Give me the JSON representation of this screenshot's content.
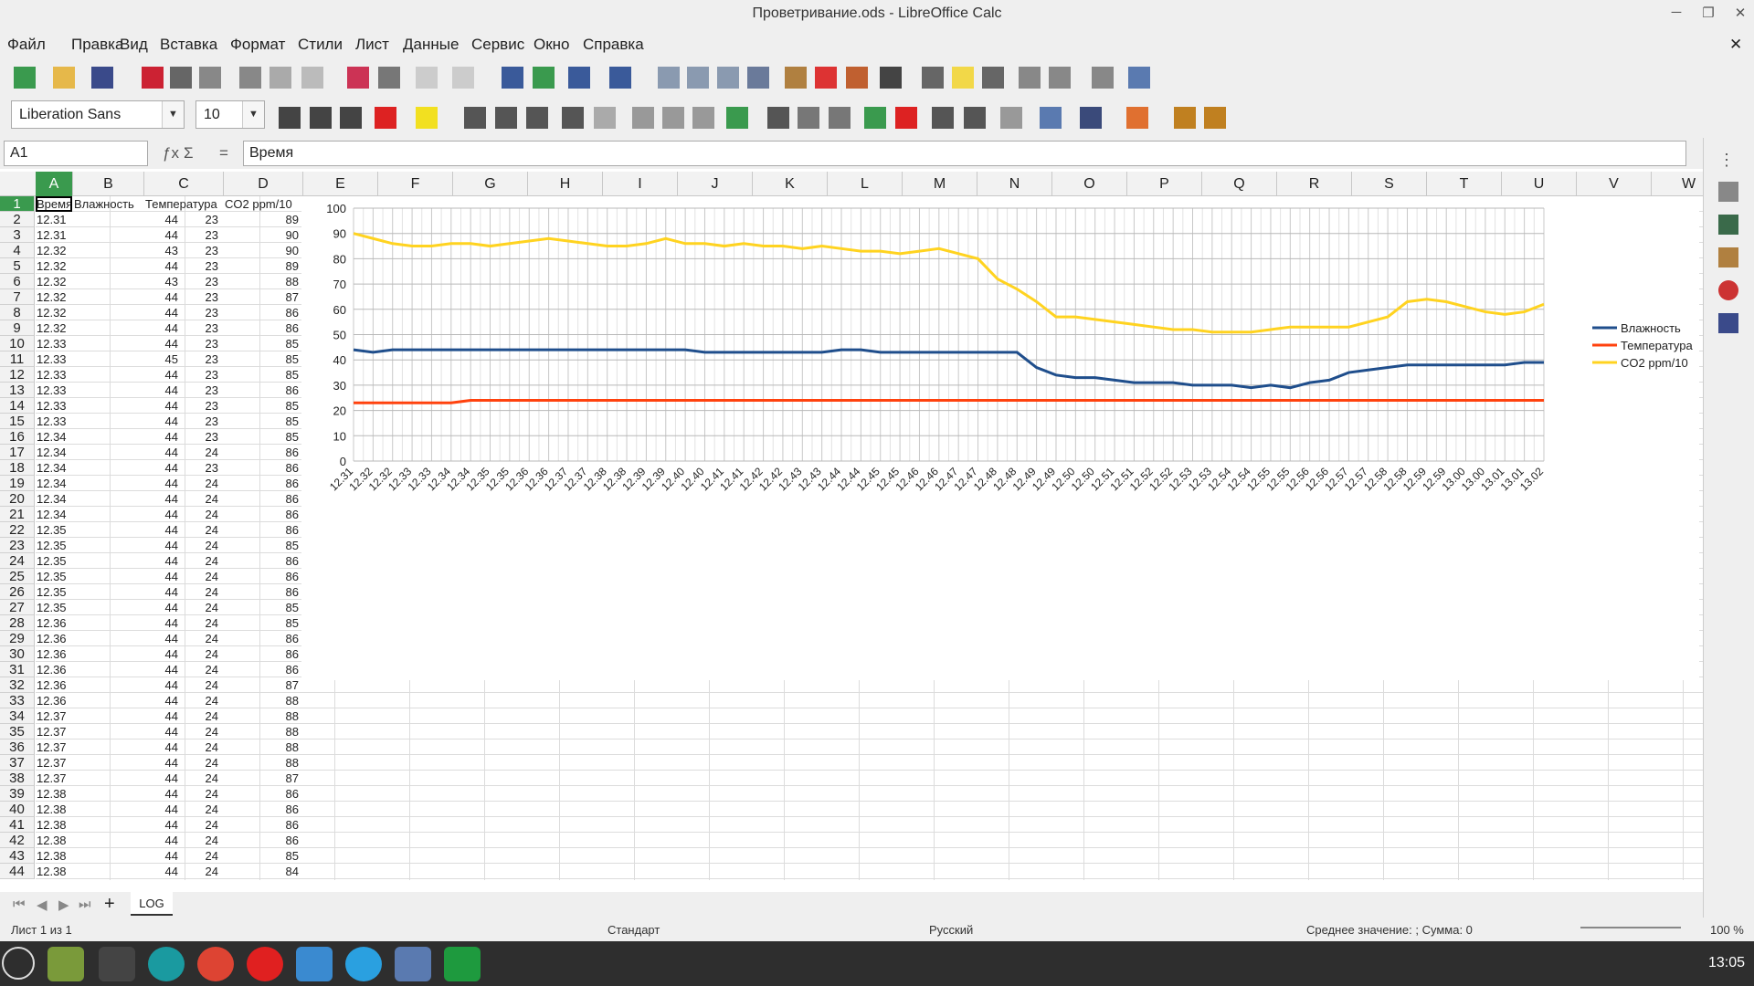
{
  "window": {
    "title": "Проветривание.ods - LibreOffice Calc"
  },
  "menu": [
    "Файл",
    "Правка",
    "Вид",
    "Вставка",
    "Формат",
    "Стили",
    "Лист",
    "Данные",
    "Сервис",
    "Окно",
    "Справка"
  ],
  "font": {
    "name": "Liberation Sans",
    "size": "10"
  },
  "formula": {
    "cell": "A1",
    "value": "Время"
  },
  "columns": [
    "A",
    "B",
    "C",
    "D",
    "E",
    "F",
    "G",
    "H",
    "I",
    "J",
    "K",
    "L",
    "M",
    "N",
    "O",
    "P",
    "Q",
    "R",
    "S",
    "T",
    "U",
    "V",
    "W"
  ],
  "header_row": [
    "Время",
    "Влажность",
    "Температура",
    "CO2 ppm/10"
  ],
  "rows": [
    [
      "12.31",
      "44",
      "23",
      "89"
    ],
    [
      "12.31",
      "44",
      "23",
      "90"
    ],
    [
      "12.32",
      "43",
      "23",
      "90"
    ],
    [
      "12.32",
      "44",
      "23",
      "89"
    ],
    [
      "12.32",
      "43",
      "23",
      "88"
    ],
    [
      "12.32",
      "44",
      "23",
      "87"
    ],
    [
      "12.32",
      "44",
      "23",
      "86"
    ],
    [
      "12.32",
      "44",
      "23",
      "86"
    ],
    [
      "12.33",
      "44",
      "23",
      "85"
    ],
    [
      "12.33",
      "45",
      "23",
      "85"
    ],
    [
      "12.33",
      "44",
      "23",
      "85"
    ],
    [
      "12.33",
      "44",
      "23",
      "86"
    ],
    [
      "12.33",
      "44",
      "23",
      "85"
    ],
    [
      "12.33",
      "44",
      "23",
      "85"
    ],
    [
      "12.34",
      "44",
      "23",
      "85"
    ],
    [
      "12.34",
      "44",
      "24",
      "86"
    ],
    [
      "12.34",
      "44",
      "23",
      "86"
    ],
    [
      "12.34",
      "44",
      "24",
      "86"
    ],
    [
      "12.34",
      "44",
      "24",
      "86"
    ],
    [
      "12.34",
      "44",
      "24",
      "86"
    ],
    [
      "12.35",
      "44",
      "24",
      "86"
    ],
    [
      "12.35",
      "44",
      "24",
      "85"
    ],
    [
      "12.35",
      "44",
      "24",
      "86"
    ],
    [
      "12.35",
      "44",
      "24",
      "86"
    ],
    [
      "12.35",
      "44",
      "24",
      "86"
    ],
    [
      "12.35",
      "44",
      "24",
      "85"
    ],
    [
      "12.36",
      "44",
      "24",
      "85"
    ],
    [
      "12.36",
      "44",
      "24",
      "86"
    ],
    [
      "12.36",
      "44",
      "24",
      "86"
    ],
    [
      "12.36",
      "44",
      "24",
      "86"
    ],
    [
      "12.36",
      "44",
      "24",
      "87"
    ],
    [
      "12.36",
      "44",
      "24",
      "88"
    ],
    [
      "12.37",
      "44",
      "24",
      "88"
    ],
    [
      "12.37",
      "44",
      "24",
      "88"
    ],
    [
      "12.37",
      "44",
      "24",
      "88"
    ],
    [
      "12.37",
      "44",
      "24",
      "88"
    ],
    [
      "12.37",
      "44",
      "24",
      "87"
    ],
    [
      "12.38",
      "44",
      "24",
      "86"
    ],
    [
      "12.38",
      "44",
      "24",
      "86"
    ],
    [
      "12.38",
      "44",
      "24",
      "86"
    ],
    [
      "12.38",
      "44",
      "24",
      "86"
    ],
    [
      "12.38",
      "44",
      "24",
      "85"
    ],
    [
      "12.38",
      "44",
      "24",
      "84"
    ]
  ],
  "chart_data": {
    "type": "line",
    "ylim": [
      0,
      100
    ],
    "yticks": [
      0,
      10,
      20,
      30,
      40,
      50,
      60,
      70,
      80,
      90,
      100
    ],
    "x_labels": [
      "12.31",
      "12.32",
      "12.32",
      "12.33",
      "12.33",
      "12.34",
      "12.34",
      "12.35",
      "12.35",
      "12.36",
      "12.36",
      "12.37",
      "12.37",
      "12.38",
      "12.38",
      "12.39",
      "12.39",
      "12.40",
      "12.40",
      "12.41",
      "12.41",
      "12.42",
      "12.42",
      "12.43",
      "12.43",
      "12.44",
      "12.44",
      "12.45",
      "12.45",
      "12.46",
      "12.46",
      "12.47",
      "12.47",
      "12.48",
      "12.48",
      "12.49",
      "12.49",
      "12.50",
      "12.50",
      "12.51",
      "12.51",
      "12.52",
      "12.52",
      "12.53",
      "12.53",
      "12.54",
      "12.54",
      "12.55",
      "12.55",
      "12.56",
      "12.56",
      "12.57",
      "12.57",
      "12.58",
      "12.58",
      "12.59",
      "12.59",
      "13.00",
      "13.00",
      "13.01",
      "13.01",
      "13.02"
    ],
    "grid": true,
    "legend_position": "right",
    "series": [
      {
        "name": "Влажность",
        "color": "#1f4e8c",
        "values": [
          44,
          43,
          44,
          44,
          44,
          44,
          44,
          44,
          44,
          44,
          44,
          44,
          44,
          44,
          44,
          44,
          44,
          44,
          43,
          43,
          43,
          43,
          43,
          43,
          43,
          44,
          44,
          43,
          43,
          43,
          43,
          43,
          43,
          43,
          43,
          37,
          34,
          33,
          33,
          32,
          31,
          31,
          31,
          30,
          30,
          30,
          29,
          30,
          29,
          31,
          32,
          35,
          36,
          37,
          38,
          38,
          38,
          38,
          38,
          38,
          39,
          39
        ]
      },
      {
        "name": "Температура",
        "color": "#ff420e",
        "values": [
          23,
          23,
          23,
          23,
          23,
          23,
          24,
          24,
          24,
          24,
          24,
          24,
          24,
          24,
          24,
          24,
          24,
          24,
          24,
          24,
          24,
          24,
          24,
          24,
          24,
          24,
          24,
          24,
          24,
          24,
          24,
          24,
          24,
          24,
          24,
          24,
          24,
          24,
          24,
          24,
          24,
          24,
          24,
          24,
          24,
          24,
          24,
          24,
          24,
          24,
          24,
          24,
          24,
          24,
          24,
          24,
          24,
          24,
          24,
          24,
          24,
          24
        ]
      },
      {
        "name": "CO2 ppm/10",
        "color": "#ffd320",
        "values": [
          90,
          88,
          86,
          85,
          85,
          86,
          86,
          85,
          86,
          87,
          88,
          87,
          86,
          85,
          85,
          86,
          88,
          86,
          86,
          85,
          86,
          85,
          85,
          84,
          85,
          84,
          83,
          83,
          82,
          83,
          84,
          82,
          80,
          72,
          68,
          63,
          57,
          57,
          56,
          55,
          54,
          53,
          52,
          52,
          51,
          51,
          51,
          52,
          53,
          53,
          53,
          53,
          55,
          57,
          63,
          64,
          63,
          61,
          59,
          58,
          59,
          62
        ]
      }
    ]
  },
  "sheet_tab": "LOG",
  "status": {
    "sheet": "Лист 1 из 1",
    "style": "Стандарт",
    "lang": "Русский",
    "sum": "Среднее значение: ; Сумма: 0",
    "zoom": "100 %"
  },
  "clock": "13:05"
}
